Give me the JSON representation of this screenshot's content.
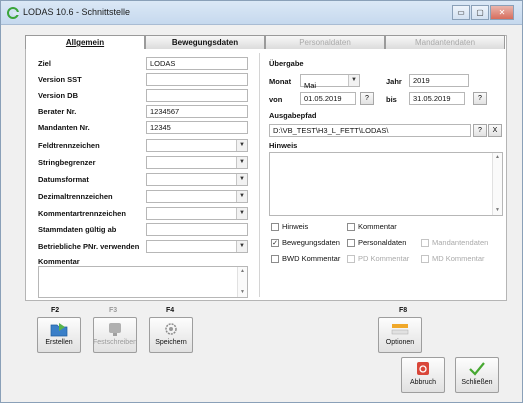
{
  "window": {
    "title": "LODAS 10.6 - Schnittstelle",
    "min_icon": "minimize-icon",
    "max_icon": "maximize-icon",
    "close_icon": "close-icon",
    "min_glyph": "▭",
    "max_glyph": "▢",
    "close_glyph": "✕"
  },
  "tabs": [
    {
      "label": "Allgemein",
      "active": true,
      "enabled": true
    },
    {
      "label": "Bewegungsdaten",
      "active": false,
      "enabled": true
    },
    {
      "label": "Personaldaten",
      "active": false,
      "enabled": false
    },
    {
      "label": "Mandantendaten",
      "active": false,
      "enabled": false
    }
  ],
  "left": {
    "ziel": {
      "label": "Ziel",
      "value": "LODAS"
    },
    "version_sst": {
      "label": "Version SST",
      "value": ""
    },
    "version_db": {
      "label": "Version DB",
      "value": ""
    },
    "berater": {
      "label": "Berater Nr.",
      "value": "1234567"
    },
    "mandanten": {
      "label": "Mandanten Nr.",
      "value": "12345"
    },
    "feldtrenn": {
      "label": "Feldtrennzeichen",
      "value": ""
    },
    "stringbeg": {
      "label": "Stringbegrenzer",
      "value": ""
    },
    "datumsformat": {
      "label": "Datumsformat",
      "value": ""
    },
    "dezimal": {
      "label": "Dezimaltrennzeichen",
      "value": ""
    },
    "kommentartrenn": {
      "label": "Kommentartrennzeichen",
      "value": ""
    },
    "stammdaten": {
      "label": "Stammdaten gültig ab",
      "value": ""
    },
    "betrieblich": {
      "label": "Betriebliche PNr. verwenden",
      "value": ""
    },
    "kommentar": {
      "label": "Kommentar",
      "value": ""
    }
  },
  "right": {
    "uebergabe": "Übergabe",
    "monat": {
      "label": "Monat",
      "value": "Mai"
    },
    "jahr": {
      "label": "Jahr",
      "value": "2019"
    },
    "von": {
      "label": "von",
      "value": "01.05.2019"
    },
    "bis": {
      "label": "bis",
      "value": "31.05.2019"
    },
    "ausgabepfad": {
      "label": "Ausgabepfad",
      "value": "D:\\VB_TEST\\H3_L_FETT\\LODAS\\"
    },
    "hinweis_label": "Hinweis",
    "help_glyph": "?",
    "clear_glyph": "X",
    "checks": [
      {
        "label": "Hinweis",
        "checked": false,
        "enabled": true
      },
      {
        "label": "Kommentar",
        "checked": false,
        "enabled": true
      },
      {
        "label": "Bewegungsdaten",
        "checked": true,
        "enabled": true
      },
      {
        "label": "Personaldaten",
        "checked": false,
        "enabled": true
      },
      {
        "label": "Mandantendaten",
        "checked": false,
        "enabled": false
      },
      {
        "label": "BWD Kommentar",
        "checked": false,
        "enabled": true
      },
      {
        "label": "PD Kommentar",
        "checked": false,
        "enabled": false
      },
      {
        "label": "MD Kommentar",
        "checked": false,
        "enabled": false
      }
    ]
  },
  "toolbar": {
    "f2": "F2",
    "f3": "F3",
    "f4": "F4",
    "f8": "F8",
    "erstellen": "Erstellen",
    "festschreiben": "Festschreiben",
    "speichern": "Speichern",
    "optionen": "Optionen",
    "abbruch": "Abbruch",
    "schliessen": "Schließen"
  },
  "colors": {
    "accent": "#2b6fb8",
    "checkmark": "#47a832",
    "abbruch": "#d9473a"
  }
}
